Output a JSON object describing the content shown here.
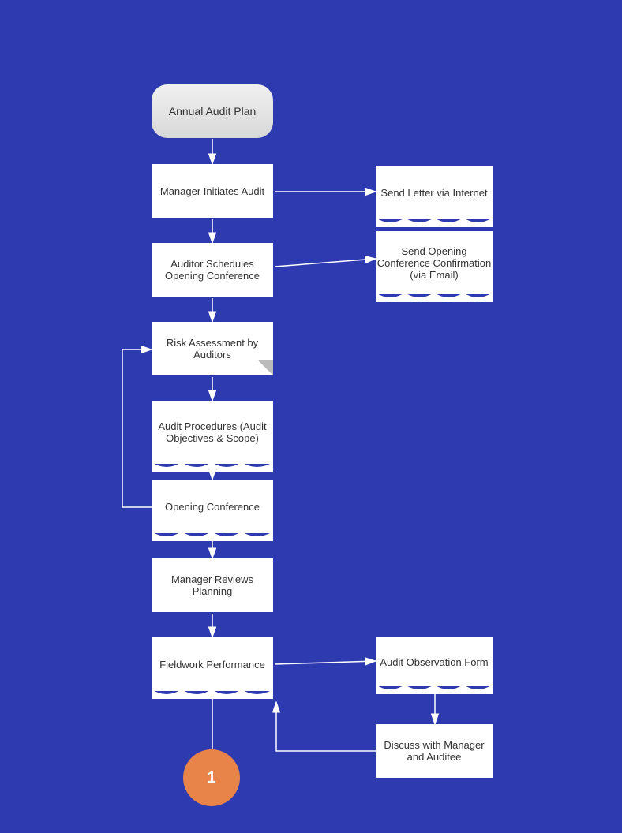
{
  "nodes": {
    "annual_audit_plan": {
      "label": "Annual Audit Plan",
      "type": "rounded"
    },
    "manager_initiates": {
      "label": "Manager Initiates Audit",
      "type": "rect"
    },
    "auditor_schedules": {
      "label": "Auditor Schedules Opening Conference",
      "type": "rect"
    },
    "risk_assessment": {
      "label": "Risk Assessment by Auditors",
      "type": "folded"
    },
    "audit_procedures": {
      "label": "Audit Procedures (Audit Objectives & Scope)",
      "type": "wave_bottom"
    },
    "opening_conference": {
      "label": "Opening Conference",
      "type": "wave_bottom"
    },
    "manager_reviews": {
      "label": "Manager Reviews Planning",
      "type": "rect"
    },
    "fieldwork": {
      "label": "Fieldwork Performance",
      "type": "wave_bottom"
    },
    "send_letter": {
      "label": "Send  Letter via Internet",
      "type": "wave"
    },
    "send_opening": {
      "label": "Send Opening Conference Confirmation (via Email)",
      "type": "wave"
    },
    "audit_observation": {
      "label": "Audit Observation Form",
      "type": "wave"
    },
    "discuss": {
      "label": "Discuss with Manager and Auditee",
      "type": "rect"
    },
    "circle_1": {
      "label": "1",
      "type": "circle"
    }
  },
  "colors": {
    "background": "#2D3AB0",
    "node_bg": "#ffffff",
    "node_rounded_bg": "#e0e0e0",
    "circle_bg": "#E8834A",
    "arrow": "#ffffff",
    "text": "#333333"
  }
}
